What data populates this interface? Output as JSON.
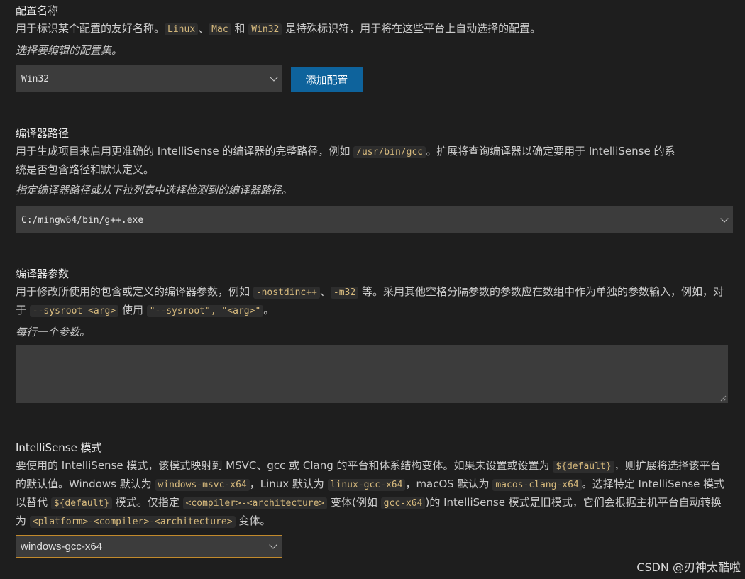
{
  "config_name": {
    "title": "配置名称",
    "desc_part1": "用于标识某个配置的友好名称。",
    "code_linux": "Linux",
    "sep1": "、",
    "code_mac": "Mac",
    "sep2": " 和 ",
    "code_win32": "Win32",
    "desc_part2": " 是特殊标识符，用于将在这些平台上自动选择的配置。",
    "hint": "选择要编辑的配置集。",
    "select_value": "Win32",
    "add_button_label": "添加配置"
  },
  "compiler_path": {
    "title": "编译器路径",
    "desc_part1": "用于生成项目来启用更准确的 IntelliSense 的编译器的完整路径，例如 ",
    "code_example": "/usr/bin/gcc",
    "desc_part2": "。扩展将查询编译器以确定要用于 IntelliSense 的系统是否包含路径和默认定义。",
    "hint": "指定编译器路径或从下拉列表中选择检测到的编译器路径。",
    "value": "C:/mingw64/bin/g++.exe"
  },
  "compiler_args": {
    "title": "编译器参数",
    "desc_part1": "用于修改所使用的包含或定义的编译器参数，例如 ",
    "code_nostdinc": "-nostdinc++",
    "sep1": "、",
    "code_m32": "-m32",
    "desc_part2": " 等。采用其他空格分隔参数的参数应在数组中作为单独的参数输入，例如，对于 ",
    "code_sysroot": "--sysroot <arg>",
    "desc_part3": " 使用 ",
    "code_sysroot_array": "\"--sysroot\", \"<arg>\"",
    "desc_part4": "。",
    "hint": "每行一个参数。",
    "value": ""
  },
  "intellisense_mode": {
    "title": "IntelliSense 模式",
    "desc_part1": "要使用的 IntelliSense 模式，该模式映射到 MSVC、gcc 或 Clang 的平台和体系结构变体。如果未设置或设置为 ",
    "code_default1": "${default}",
    "desc_part2": "，则扩展将选择该平台的默认值。Windows 默认为 ",
    "code_win_default": "windows-msvc-x64",
    "desc_part3": "，Linux 默认为 ",
    "code_linux_default": "linux-gcc-x64",
    "desc_part4": "，macOS 默认为 ",
    "code_mac_default": "macos-clang-x64",
    "desc_part5": "。选择特定 IntelliSense 模式以替代 ",
    "code_default2": "${default}",
    "desc_part6": " 模式。仅指定 ",
    "code_compiler_arch": "<compiler>-<architecture>",
    "desc_part7": " 变体(例如 ",
    "code_gcc_x64": "gcc-x64",
    "desc_part8": ")的 IntelliSense 模式是旧模式，它们会根据主机平台自动转换为 ",
    "code_platform_compiler_arch": "<platform>-<compiler>-<architecture>",
    "desc_part9": " 变体。",
    "value": "windows-gcc-x64"
  },
  "watermark": "CSDN @刃神太酷啦",
  "colors": {
    "background": "#1e1e1e",
    "input_background": "#3c3c3c",
    "button_background": "#0e639c",
    "focus_border": "#c28a2c",
    "code_text": "#d7ba7d"
  },
  "icons": {
    "dropdown": "chevron-down-icon",
    "resize": "resize-grip-icon"
  }
}
